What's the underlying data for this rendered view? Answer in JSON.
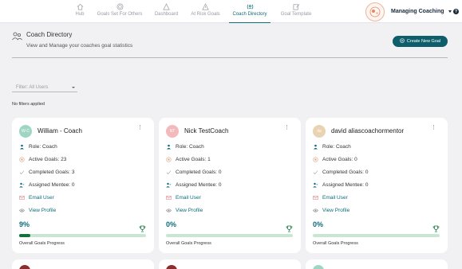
{
  "nav": {
    "tabs": [
      {
        "label": "Hub",
        "icon": "home-icon"
      },
      {
        "label": "Goals Set For Others",
        "icon": "target-icon"
      },
      {
        "label": "Dashboard",
        "icon": "triangle-icon"
      },
      {
        "label": "At Risk Goals",
        "icon": "alert-icon"
      },
      {
        "label": "Coach Directory",
        "icon": "coach-icon",
        "active": true
      },
      {
        "label": "Goal Template",
        "icon": "edit-icon"
      }
    ],
    "user_label": "Managing Coaching",
    "help": "?"
  },
  "header": {
    "title": "Coach Directory",
    "subtitle": "View and Manage your coaches goal statistics",
    "create_button": "Create New Goal"
  },
  "filter": {
    "placeholder": "Filter: All Users",
    "status": "No filters applied"
  },
  "labels": {
    "role": "Role:",
    "active": "Active Goals:",
    "completed": "Completed Goals:",
    "mentee": "Assigned Mentee:",
    "email": "Email User",
    "profile": "View Profile",
    "overall": "Overall Goals Progress"
  },
  "coaches": [
    {
      "initials": "W-C",
      "name": "William - Coach",
      "avatar_color": "#9fd6c3",
      "role": "Role: Coach",
      "active": "Active Goals: 23",
      "completed": "Completed Goals: 3",
      "mentee": "Assigned Mentee: 0",
      "email": "Email User",
      "profile": "View Profile",
      "progress_label": "9%",
      "progress": 0.09
    },
    {
      "initials": "NT",
      "name": "Nick TestCoach",
      "avatar_color": "#f3b9bb",
      "role": "Role: Coach",
      "active": "Active Goals: 1",
      "completed": "Completed Goals: 0",
      "mentee": "Assigned Mentee: 0",
      "email": "Email User",
      "profile": "View Profile",
      "progress_label": "0%",
      "progress": 0
    },
    {
      "initials": "da",
      "name": "david aliascoachormentor",
      "avatar_color": "#e9d3b3",
      "role": "Role: Coach",
      "active": "Active Goals: 0",
      "completed": "Completed Goals: 0",
      "mentee": "Assigned Mentee: 0",
      "email": "Email User",
      "profile": "View Profile",
      "progress_label": "0%",
      "progress": 0
    }
  ],
  "colors": {
    "accent": "#0e6b7a",
    "progress_fill": "#14713b",
    "progress_track": "#c9e6d2"
  }
}
